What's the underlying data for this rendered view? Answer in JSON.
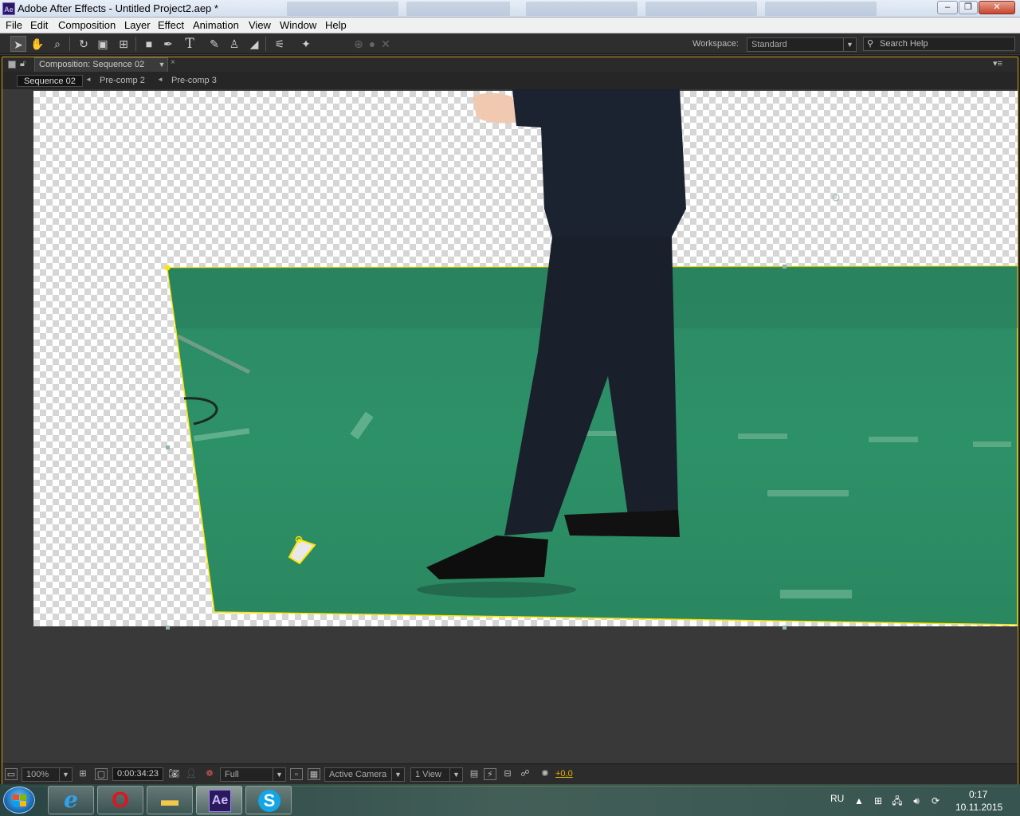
{
  "window": {
    "title": "Adobe After Effects - Untitled Project2.aep *",
    "app_icon": "Ae",
    "min": "–",
    "max": "❐",
    "close": "✕"
  },
  "menu": [
    "File",
    "Edit",
    "Composition",
    "Layer",
    "Effect",
    "Animation",
    "View",
    "Window",
    "Help"
  ],
  "toolbar": {
    "workspace_label": "Workspace:",
    "workspace_value": "Standard",
    "search_placeholder": "Search Help"
  },
  "panel": {
    "tab_label": "Composition: Sequence 02",
    "close": "×",
    "menu": "▾≡"
  },
  "breadcrumbs": [
    "Sequence 02",
    "Pre-comp 2",
    "Pre-comp 3"
  ],
  "viewer_footer": {
    "zoom": "100%",
    "timecode": "0:00:34:23",
    "resolution": "Full",
    "camera": "Active Camera",
    "views": "1 View",
    "exposure": "+0,0"
  },
  "tray": {
    "language": "RU",
    "time": "0:17",
    "date": "10.11.2015"
  },
  "colors": {
    "accent_yellow": "#ffe400",
    "panel_border": "#c99a1e",
    "green_screen": "#2f8a63"
  }
}
